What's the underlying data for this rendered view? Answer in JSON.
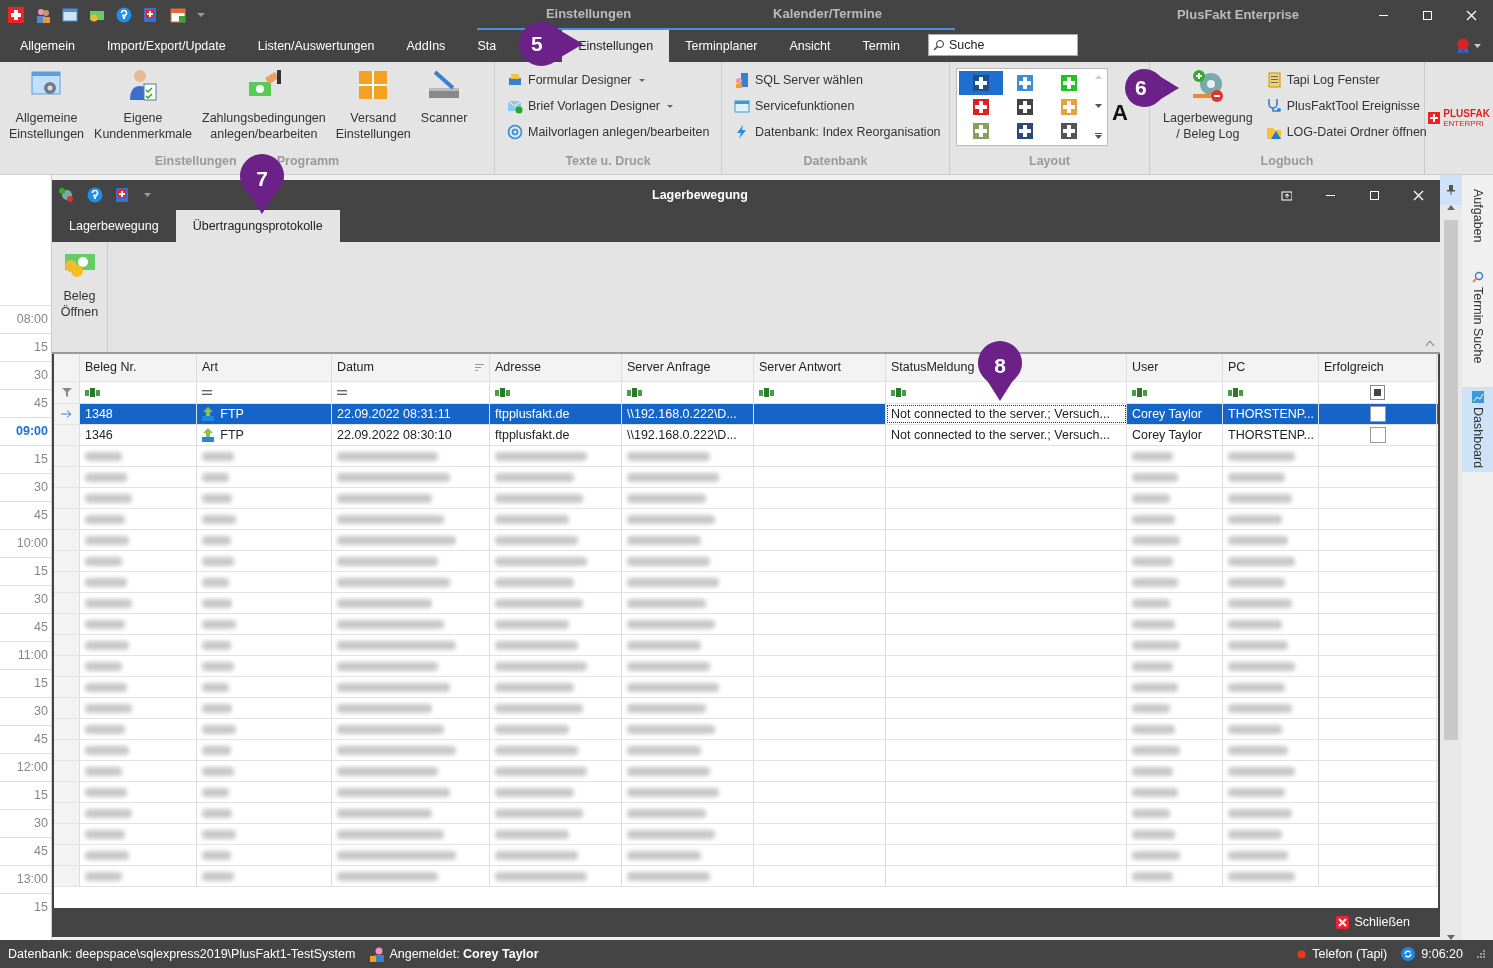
{
  "app": {
    "title": "PlusFakt Enterprise",
    "context_groups": [
      {
        "label": "Einstellungen"
      },
      {
        "label": "Kalender/Termine"
      }
    ]
  },
  "quick_access": [
    {
      "kind": "flag"
    },
    {
      "kind": "people"
    },
    {
      "kind": "window"
    },
    {
      "kind": "money"
    },
    {
      "kind": "help"
    },
    {
      "kind": "plusdoc"
    },
    {
      "kind": "calendar"
    }
  ],
  "menu_tabs": [
    {
      "label": "Allgemein",
      "selected": false
    },
    {
      "label": "Import/Export/Update",
      "selected": false
    },
    {
      "label": "Listen/Auswertungen",
      "selected": false
    },
    {
      "label": "AddIns",
      "selected": false
    },
    {
      "label": "Sta",
      "selected": false
    },
    {
      "label": "Einstellungen",
      "selected": true
    },
    {
      "label": "Terminplaner",
      "selected": false
    },
    {
      "label": "Ansicht",
      "selected": false
    },
    {
      "label": "Termin",
      "selected": false
    }
  ],
  "search": {
    "placeholder": "Suche"
  },
  "ribbon": {
    "settings_group": {
      "label_start": "Einstellungen",
      "label_end": "Programm",
      "buttons": [
        {
          "lines": [
            "Allgemeine",
            "Einstellungen"
          ],
          "kind": "settings"
        },
        {
          "lines": [
            "Eigene",
            "Kundenmerkmale"
          ],
          "kind": "person"
        },
        {
          "lines": [
            "Zahlungsbedingungen",
            "anlegen/bearbeiten"
          ],
          "kind": "money"
        },
        {
          "lines": [
            "Versand",
            "Einstellungen"
          ],
          "kind": "box"
        },
        {
          "lines": [
            "Scanner"
          ],
          "kind": "scanner"
        }
      ]
    },
    "text_group": {
      "label": "Texte u. Druck",
      "items": [
        {
          "label": "Formular Designer",
          "dropdown": true,
          "kind": "form"
        },
        {
          "label": "Brief Vorlagen Designer",
          "dropdown": true,
          "kind": "mail"
        },
        {
          "label": "Mailvorlagen anlegen/bearbeiten",
          "dropdown": false,
          "kind": "at"
        }
      ]
    },
    "db_group": {
      "label": "Datenbank",
      "items": [
        {
          "label": "SQL Server wählen",
          "kind": "server"
        },
        {
          "label": "Servicefunktionen",
          "kind": "window"
        },
        {
          "label": "Datenbank: Index Reorganisation",
          "kind": "bolt"
        }
      ]
    },
    "layout_group": {
      "label": "Layout",
      "extra": "A",
      "tiles": [
        {
          "color": "#1f4e8c",
          "selected": true
        },
        {
          "color": "#3a8fd8",
          "selected": false
        },
        {
          "color": "#22c322",
          "selected": false
        },
        {
          "color": "#e02020",
          "selected": false
        },
        {
          "color": "#444444",
          "selected": false
        },
        {
          "color": "#e8a040",
          "selected": false
        },
        {
          "color": "#8aa060",
          "selected": false
        },
        {
          "color": "#2a4a7a",
          "selected": false
        },
        {
          "color": "#555555",
          "selected": false
        }
      ]
    },
    "log_group": {
      "label": "Logbuch",
      "large": {
        "lines": [
          "Lagerbewegung",
          "/ Beleg Log"
        ]
      },
      "items": [
        {
          "label": "Tapi Log Fenster",
          "kind": "doc"
        },
        {
          "label": "PlusFaktTool Ereignisse",
          "kind": "stetho"
        },
        {
          "label": "LOG-Datei Ordner öffnen",
          "kind": "warnfolder"
        }
      ]
    },
    "logo": {
      "name": "PLUSFAK",
      "sub": "ENTERPRI"
    }
  },
  "calendar": {
    "slots": [
      {
        "label": "08:00",
        "current": false
      },
      {
        "label": "15",
        "current": false
      },
      {
        "label": "30",
        "current": false
      },
      {
        "label": "45",
        "current": false
      },
      {
        "label": "09:00",
        "current": true
      },
      {
        "label": "15",
        "current": false
      },
      {
        "label": "30",
        "current": false
      },
      {
        "label": "45",
        "current": false
      },
      {
        "label": "10:00",
        "current": false
      },
      {
        "label": "15",
        "current": false
      },
      {
        "label": "30",
        "current": false
      },
      {
        "label": "45",
        "current": false
      },
      {
        "label": "11:00",
        "current": false
      },
      {
        "label": "15",
        "current": false
      },
      {
        "label": "30",
        "current": false
      },
      {
        "label": "45",
        "current": false
      },
      {
        "label": "12:00",
        "current": false
      },
      {
        "label": "15",
        "current": false
      },
      {
        "label": "30",
        "current": false
      },
      {
        "label": "45",
        "current": false
      },
      {
        "label": "13:00",
        "current": false
      },
      {
        "label": "15",
        "current": false
      }
    ]
  },
  "side_tabs": [
    {
      "label": "Aufgaben",
      "selected": false
    },
    {
      "label": "Termin Suche",
      "selected": false
    },
    {
      "label": "Dashboard",
      "selected": true
    }
  ],
  "window": {
    "title": "Lagerbewegung",
    "tabs": [
      {
        "label": "Lagerbewegung",
        "selected": false
      },
      {
        "label": "Übertragungsprotokolle",
        "selected": true
      }
    ],
    "toolbar": [
      {
        "lines": [
          "Beleg",
          "Öffnen"
        ]
      }
    ],
    "table": {
      "columns": [
        {
          "label": "Beleg Nr.",
          "kind": "text"
        },
        {
          "label": "Art",
          "kind": "equals"
        },
        {
          "label": "Datum",
          "kind": "equals",
          "sorted": true
        },
        {
          "label": "Adresse",
          "kind": "text"
        },
        {
          "label": "Server Anfrage",
          "kind": "text"
        },
        {
          "label": "Server Antwort",
          "kind": "text"
        },
        {
          "label": "StatusMeldung",
          "kind": "text"
        },
        {
          "label": "User",
          "kind": "text"
        },
        {
          "label": "PC",
          "kind": "text"
        },
        {
          "label": "Erfolgreich",
          "kind": "check",
          "filter_indeterminate": true
        }
      ],
      "rows": [
        {
          "selected": true,
          "cells": [
            "1348",
            "FTP",
            "22.09.2022 08:31:11",
            "ftpplusfakt.de",
            "\\\\192.168.0.222\\D...",
            "",
            "Not connected to the server.; Versuch...",
            "Corey Taylor",
            "THORSTENP..."
          ],
          "checked": false
        },
        {
          "selected": false,
          "cells": [
            "1346",
            "FTP",
            "22.09.2022 08:30:10",
            "ftpplusfakt.de",
            "\\\\192.168.0.222\\D...",
            "",
            "Not connected to the server.; Versuch...",
            "Corey Taylor",
            "THORSTENP..."
          ],
          "checked": false
        }
      ],
      "blurred_rows": [
        {
          "kind": "redacted"
        },
        {
          "kind": "redacted"
        },
        {
          "kind": "redacted"
        },
        {
          "kind": "redacted"
        },
        {
          "kind": "redacted"
        },
        {
          "kind": "redacted"
        },
        {
          "kind": "redacted"
        },
        {
          "kind": "redacted"
        },
        {
          "kind": "redacted"
        },
        {
          "kind": "redacted"
        },
        {
          "kind": "redacted"
        },
        {
          "kind": "redacted"
        },
        {
          "kind": "redacted"
        },
        {
          "kind": "redacted"
        },
        {
          "kind": "redacted"
        },
        {
          "kind": "redacted"
        },
        {
          "kind": "redacted"
        },
        {
          "kind": "redacted"
        },
        {
          "kind": "redacted"
        },
        {
          "kind": "redacted"
        },
        {
          "kind": "redacted"
        }
      ]
    },
    "close_button": "Schließen"
  },
  "callouts": [
    {
      "label": "5",
      "kind": "right"
    },
    {
      "label": "6",
      "kind": "right"
    },
    {
      "label": "7",
      "kind": "down"
    },
    {
      "label": "8",
      "kind": "down"
    }
  ],
  "status_bar": {
    "database": "Datenbank: deepspace\\sqlexpress2019\\PlusFakt1-TestSystem",
    "user": "Angemeldet: **Corey Taylor**",
    "phone": "Telefon (Tapi)",
    "time": "9:06:20"
  }
}
